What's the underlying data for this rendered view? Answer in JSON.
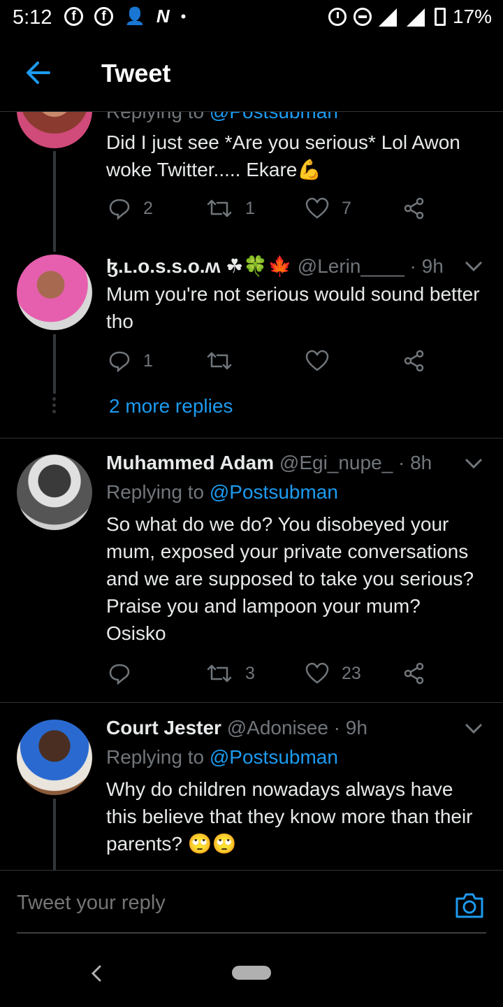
{
  "status_bar": {
    "time": "5:12",
    "left_icons": [
      "facebook-icon",
      "facebook-icon",
      "add-person-icon",
      "n-icon",
      "dot"
    ],
    "network": "3G",
    "battery": "17%"
  },
  "header": {
    "title": "Tweet"
  },
  "colors": {
    "accent": "#1d9bf0",
    "muted": "#71767b",
    "background": "#000000"
  },
  "tweets": [
    {
      "reply_prefix": "Replying to ",
      "reply_to": "@Postsubman",
      "text": "Did I just see *Are you serious* Lol Awon woke Twitter..... Ekare💪",
      "counts": {
        "reply": "2",
        "retweet": "1",
        "like": "7"
      }
    },
    {
      "name": "ɮ.ʟ.o.s.s.o.ʍ ☘🍀🍁",
      "handle": "@Lerin____",
      "time": " · 9h",
      "text": "Mum you're not serious would sound better tho",
      "counts": {
        "reply": "1",
        "retweet": "",
        "like": ""
      },
      "more_replies": "2 more replies"
    },
    {
      "name": "Muhammed Adam",
      "handle": "@Egi_nupe_",
      "time": " · 8h",
      "reply_prefix": "Replying to ",
      "reply_to": "@Postsubman",
      "text": "So what do we do? You disobeyed your mum, exposed your private conversations and we are supposed to take you serious? Praise you and lampoon your mum? Osisko",
      "counts": {
        "reply": "",
        "retweet": "3",
        "like": "23"
      }
    },
    {
      "name": "Court Jester",
      "handle": "@Adonisee",
      "time": " · 9h",
      "reply_prefix": "Replying to ",
      "reply_to": "@Postsubman",
      "text": "Why do children nowadays always have this believe that they know more than their parents? 🙄🙄"
    }
  ],
  "reply_box": {
    "placeholder": "Tweet your reply"
  }
}
